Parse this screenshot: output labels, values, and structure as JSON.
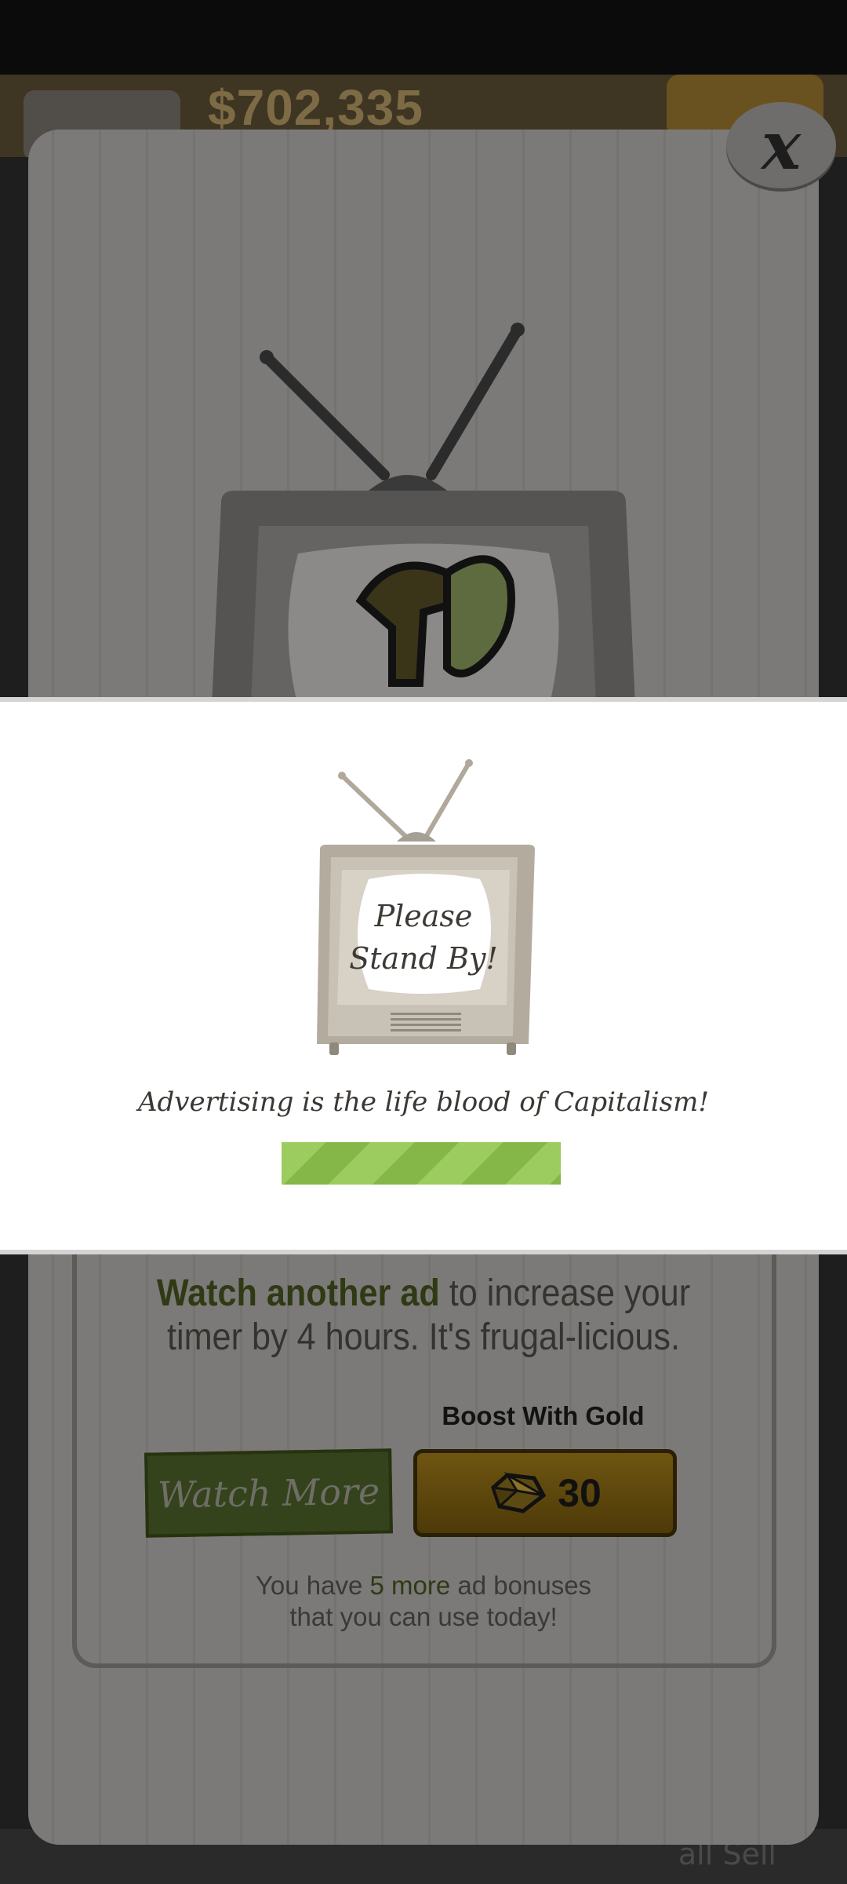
{
  "background": {
    "cash_display": "$702,335",
    "close_label": "x",
    "info": {
      "highlight": "Watch another ad",
      "rest_line1": " to increase your",
      "line2": "timer by 4 hours. It's frugal-licious."
    },
    "boost_label": "Boost With Gold",
    "watch_more_label": "Watch More",
    "gold_cost": "30",
    "bonus": {
      "prefix": "You have ",
      "highlight": "5 more",
      "suffix": " ad bonuses",
      "line2": "that you can use today!"
    },
    "bottom_partial": "all Sell"
  },
  "standby": {
    "tv_line1": "Please",
    "tv_line2": "Stand By!",
    "tagline": "Advertising is the life blood of Capitalism!",
    "progress": 1.0
  },
  "colors": {
    "progress_light": "#9ccb5f",
    "progress_dark": "#84b648",
    "tv_body": "#b0a89b",
    "highlight_text": "#2f3a15"
  },
  "icons": {
    "close": "close-icon",
    "tv": "tv-icon",
    "gem": "gold-gem-icon"
  }
}
